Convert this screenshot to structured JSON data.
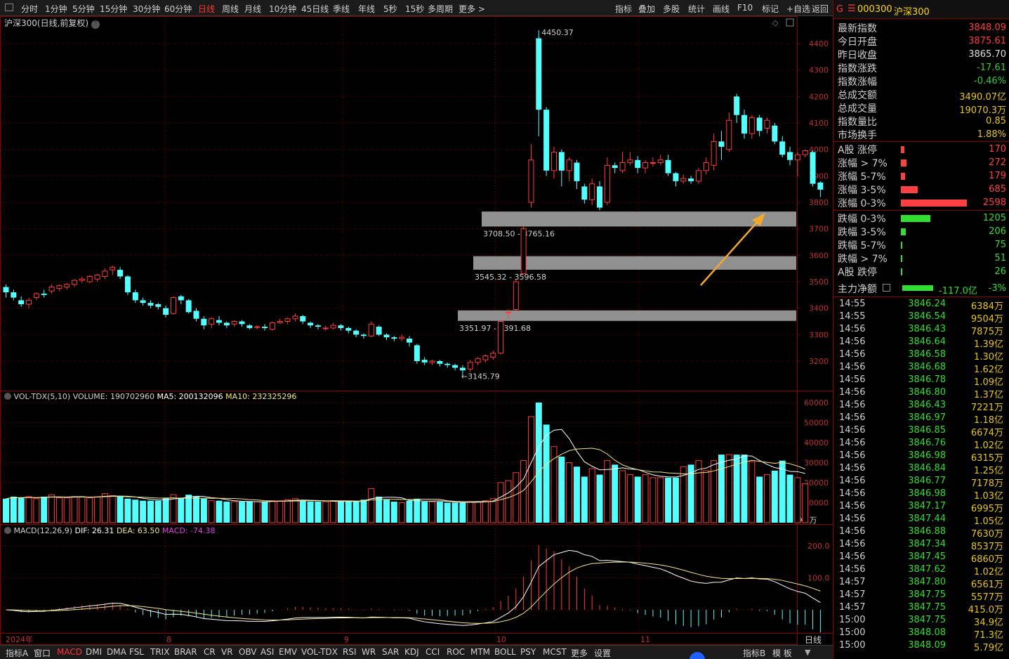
{
  "toolbar": {
    "periods": [
      "分时",
      "1分钟",
      "5分钟",
      "15分钟",
      "30分钟",
      "60分钟",
      "日线",
      "周线",
      "月线",
      "10分钟",
      "45日线",
      "季线",
      "年线",
      "5秒",
      "15秒",
      "多周期",
      "更多 >"
    ],
    "active_period": "日线",
    "actions": [
      "指标",
      "叠加",
      "多股",
      "统计",
      "画线",
      "F10",
      "标记",
      "+自选",
      "返回"
    ]
  },
  "chart": {
    "title": "沪深300(日线,前复权)",
    "candles": [
      [
        3480,
        3460,
        3490,
        3440
      ],
      [
        3460,
        3440,
        3470,
        3430
      ],
      [
        3430,
        3415,
        3445,
        3405
      ],
      [
        3415,
        3430,
        3440,
        3400
      ],
      [
        3440,
        3455,
        3460,
        3430
      ],
      [
        3455,
        3450,
        3470,
        3440
      ],
      [
        3465,
        3480,
        3490,
        3455
      ],
      [
        3475,
        3485,
        3490,
        3465
      ],
      [
        3480,
        3490,
        3495,
        3470
      ],
      [
        3490,
        3505,
        3510,
        3480
      ],
      [
        3505,
        3510,
        3520,
        3495
      ],
      [
        3500,
        3520,
        3525,
        3495
      ],
      [
        3510,
        3525,
        3530,
        3500
      ],
      [
        3520,
        3540,
        3550,
        3510
      ],
      [
        3545,
        3555,
        3560,
        3525
      ],
      [
        3545,
        3520,
        3555,
        3510
      ],
      [
        3520,
        3460,
        3525,
        3450
      ],
      [
        3460,
        3430,
        3470,
        3420
      ],
      [
        3430,
        3420,
        3440,
        3410
      ],
      [
        3420,
        3410,
        3430,
        3400
      ],
      [
        3415,
        3405,
        3420,
        3395
      ],
      [
        3400,
        3375,
        3410,
        3365
      ],
      [
        3380,
        3440,
        3445,
        3375
      ],
      [
        3445,
        3430,
        3450,
        3415
      ],
      [
        3430,
        3385,
        3435,
        3380
      ],
      [
        3390,
        3360,
        3400,
        3350
      ],
      [
        3360,
        3335,
        3370,
        3320
      ],
      [
        3340,
        3360,
        3365,
        3325
      ],
      [
        3355,
        3345,
        3370,
        3335
      ],
      [
        3345,
        3335,
        3350,
        3325
      ],
      [
        3340,
        3350,
        3355,
        3330
      ],
      [
        3350,
        3340,
        3355,
        3330
      ],
      [
        3335,
        3325,
        3340,
        3320
      ],
      [
        3330,
        3330,
        3335,
        3320
      ],
      [
        3330,
        3325,
        3340,
        3315
      ],
      [
        3320,
        3345,
        3350,
        3315
      ],
      [
        3345,
        3350,
        3360,
        3340
      ],
      [
        3350,
        3360,
        3365,
        3340
      ],
      [
        3360,
        3370,
        3380,
        3350
      ],
      [
        3370,
        3350,
        3375,
        3340
      ],
      [
        3345,
        3335,
        3350,
        3325
      ],
      [
        3335,
        3330,
        3340,
        3320
      ],
      [
        3325,
        3325,
        3335,
        3315
      ],
      [
        3325,
        3335,
        3345,
        3320
      ],
      [
        3335,
        3325,
        3340,
        3315
      ],
      [
        3325,
        3315,
        3330,
        3305
      ],
      [
        3315,
        3300,
        3320,
        3290
      ],
      [
        3300,
        3295,
        3305,
        3285
      ],
      [
        3295,
        3340,
        3350,
        3290
      ],
      [
        3330,
        3300,
        3335,
        3295
      ],
      [
        3300,
        3290,
        3305,
        3280
      ],
      [
        3290,
        3285,
        3295,
        3275
      ],
      [
        3285,
        3290,
        3300,
        3275
      ],
      [
        3285,
        3270,
        3295,
        3255
      ],
      [
        3260,
        3200,
        3265,
        3190
      ],
      [
        3205,
        3195,
        3215,
        3185
      ],
      [
        3195,
        3200,
        3205,
        3185
      ],
      [
        3200,
        3190,
        3205,
        3180
      ],
      [
        3190,
        3185,
        3195,
        3175
      ],
      [
        3185,
        3175,
        3190,
        3165
      ],
      [
        3175,
        3165,
        3185,
        3146
      ],
      [
        3170,
        3195,
        3205,
        3160
      ],
      [
        3195,
        3210,
        3215,
        3185
      ],
      [
        3205,
        3220,
        3225,
        3195
      ],
      [
        3215,
        3230,
        3240,
        3205
      ],
      [
        3230,
        3350,
        3355,
        3225
      ],
      [
        3385,
        3385,
        3395,
        3360
      ],
      [
        3395,
        3500,
        3510,
        3390
      ],
      [
        3530,
        3700,
        3710,
        3525
      ],
      [
        3800,
        3960,
        4020,
        3780
      ],
      [
        4420,
        4150,
        4450,
        4050
      ],
      [
        4150,
        3920,
        4160,
        3900
      ],
      [
        3920,
        3990,
        4010,
        3890
      ],
      [
        3990,
        3920,
        4000,
        3860
      ],
      [
        3920,
        3960,
        3970,
        3880
      ],
      [
        3950,
        3880,
        3960,
        3850
      ],
      [
        3860,
        3810,
        3870,
        3795
      ],
      [
        3810,
        3870,
        3890,
        3790
      ],
      [
        3860,
        3780,
        3880,
        3770
      ],
      [
        3800,
        3940,
        3970,
        3790
      ],
      [
        3940,
        3930,
        3950,
        3910
      ],
      [
        3920,
        3950,
        3990,
        3910
      ],
      [
        3950,
        3960,
        3990,
        3940
      ],
      [
        3960,
        3930,
        3975,
        3910
      ],
      [
        3930,
        3950,
        3960,
        3910
      ],
      [
        3950,
        3950,
        3970,
        3935
      ],
      [
        3950,
        3960,
        3980,
        3940
      ],
      [
        3960,
        3910,
        3980,
        3900
      ],
      [
        3910,
        3880,
        3915,
        3860
      ],
      [
        3880,
        3890,
        3905,
        3870
      ],
      [
        3890,
        3880,
        3900,
        3870
      ],
      [
        3880,
        3920,
        3930,
        3870
      ],
      [
        3920,
        3950,
        3970,
        3905
      ],
      [
        3940,
        4030,
        4060,
        3920
      ],
      [
        4030,
        4010,
        4070,
        3960
      ],
      [
        4000,
        4110,
        4140,
        3990
      ],
      [
        4200,
        4130,
        4210,
        4100
      ],
      [
        4130,
        4060,
        4150,
        4040
      ],
      [
        4060,
        4120,
        4130,
        4040
      ],
      [
        4120,
        4070,
        4130,
        4050
      ],
      [
        4080,
        4110,
        4120,
        4060
      ],
      [
        4090,
        4030,
        4100,
        4020
      ],
      [
        4030,
        3980,
        4050,
        3970
      ],
      [
        3990,
        3960,
        4010,
        3940
      ],
      [
        3960,
        3980,
        3990,
        3900
      ],
      [
        3980,
        3995,
        4000,
        3970
      ],
      [
        3990,
        3870,
        3995,
        3860
      ],
      [
        3875,
        3848,
        3880,
        3820
      ]
    ],
    "high_label": "4450.37",
    "low_label": "3145.79",
    "gap_bands": [
      {
        "lo": 3708.5,
        "hi": 3765.16,
        "label": "3708.50 - 3765.16"
      },
      {
        "lo": 3545.32,
        "hi": 3596.58,
        "label": "3545.32 - 3596.58"
      },
      {
        "lo": 3351.97,
        "hi": 3391.68,
        "label": "3351.97 - 3391.68"
      }
    ],
    "y_ticks": [
      "4400",
      "4300",
      "4200",
      "4100",
      "4000",
      "3900",
      "3800",
      "3700",
      "3600",
      "3500",
      "3400",
      "3300",
      "3200"
    ],
    "y_ticks_num": [
      4400,
      4300,
      4200,
      4100,
      4000,
      3900,
      3800,
      3700,
      3600,
      3500,
      3400,
      3300,
      3200
    ],
    "x_labels": [
      "2024年",
      "8",
      "9",
      "10",
      "11"
    ],
    "period_label": "日线"
  },
  "volume": {
    "name": "VOL-TDX(5,10)",
    "volume_label": "VOLUME: 190702960",
    "ma5_label": "MA5: 200132096",
    "ma10_label": "MA10: 232325296",
    "y_ticks": [
      "60000",
      "50000",
      "40000",
      "30000",
      "20000",
      "10000"
    ],
    "y_ticks_num": [
      60000,
      50000,
      40000,
      30000,
      20000,
      10000
    ],
    "unit": "X1万"
  },
  "macd": {
    "name": "MACD(12,26,9)",
    "dif_label": "DIF: 26.31",
    "dea_label": "DEA: 63.50",
    "macd_label": "MACD: -74.38",
    "y_ticks": [
      "200.0",
      "100.0"
    ],
    "y_ticks_num": [
      200,
      100
    ]
  },
  "quote": {
    "flag": "G",
    "code": "000300",
    "name": "沪深300",
    "rows": [
      {
        "k": "最新指数",
        "v": "3848.09",
        "c": "#ff3b3b"
      },
      {
        "k": "今日开盘",
        "v": "3875.61",
        "c": "#ff3b3b"
      },
      {
        "k": "昨日收盘",
        "v": "3865.70",
        "c": "#e0e0e0"
      },
      {
        "k": "指数涨跌",
        "v": "-17.61",
        "c": "#33cc33"
      },
      {
        "k": "指数涨幅",
        "v": "-0.46%",
        "c": "#33cc33"
      },
      {
        "k": "总成交额",
        "v": "3490.07亿",
        "c": "#e6c619"
      },
      {
        "k": "总成交量",
        "v": "19070.3万",
        "c": "#e6c619"
      },
      {
        "k": "指数量比",
        "v": "0.85",
        "c": "#e6c619"
      },
      {
        "k": "市场换手",
        "v": "1.88%",
        "c": "#e6c619"
      }
    ],
    "breadth": [
      {
        "k": "A股 涨停",
        "v": "170",
        "pct": 0.05,
        "c": "#ff4040"
      },
      {
        "k": "涨幅 > 7%",
        "v": "272",
        "pct": 0.08,
        "c": "#ff4040"
      },
      {
        "k": "涨幅 5-7%",
        "v": "179",
        "pct": 0.06,
        "c": "#ff4040"
      },
      {
        "k": "涨幅 3-5%",
        "v": "685",
        "pct": 0.25,
        "c": "#ff4040"
      },
      {
        "k": "涨幅 0-3%",
        "v": "2598",
        "pct": 1.0,
        "c": "#ff4040"
      },
      {
        "k": "跌幅 0-3%",
        "v": "1205",
        "pct": 0.45,
        "c": "#33dd33"
      },
      {
        "k": "跌幅 3-5%",
        "v": "206",
        "pct": 0.07,
        "c": "#33dd33"
      },
      {
        "k": "跌幅 5-7%",
        "v": "75",
        "pct": 0.02,
        "c": "#33dd33"
      },
      {
        "k": "跌幅 > 7%",
        "v": "51",
        "pct": 0.015,
        "c": "#33dd33"
      },
      {
        "k": "A股 跌停",
        "v": "26",
        "pct": 0.01,
        "c": "#33dd33"
      }
    ],
    "net_flow_label": "主力净额",
    "net_flow_value": "-117.0亿",
    "net_flow_pct": "-3%"
  },
  "ticks": [
    [
      "14:55",
      "3846.24",
      "6384万"
    ],
    [
      "14:55",
      "3846.54",
      "9504万"
    ],
    [
      "14:56",
      "3846.43",
      "7875万"
    ],
    [
      "14:56",
      "3846.64",
      "1.39亿"
    ],
    [
      "14:56",
      "3846.58",
      "1.30亿"
    ],
    [
      "14:56",
      "3846.68",
      "1.62亿"
    ],
    [
      "14:56",
      "3846.78",
      "1.09亿"
    ],
    [
      "14:56",
      "3846.80",
      "1.37亿"
    ],
    [
      "14:56",
      "3846.43",
      "7221万"
    ],
    [
      "14:56",
      "3846.97",
      "1.18亿"
    ],
    [
      "14:56",
      "3846.85",
      "6674万"
    ],
    [
      "14:56",
      "3846.76",
      "1.02亿"
    ],
    [
      "14:56",
      "3846.98",
      "6315万"
    ],
    [
      "14:56",
      "3846.84",
      "1.25亿"
    ],
    [
      "14:56",
      "3846.77",
      "7178万"
    ],
    [
      "14:56",
      "3846.98",
      "1.03亿"
    ],
    [
      "14:56",
      "3847.17",
      "6995万"
    ],
    [
      "14:56",
      "3847.44",
      "1.05亿"
    ],
    [
      "14:56",
      "3846.88",
      "7630万"
    ],
    [
      "14:56",
      "3847.34",
      "8537万"
    ],
    [
      "14:56",
      "3847.45",
      "6860万"
    ],
    [
      "14:56",
      "3847.62",
      "1.02亿"
    ],
    [
      "14:57",
      "3847.80",
      "6561万"
    ],
    [
      "14:57",
      "3847.75",
      "5577万"
    ],
    [
      "14:57",
      "3847.75",
      "415.0万"
    ],
    [
      "15:00",
      "3847.75",
      "34.9亿"
    ],
    [
      "15:00",
      "3848.08",
      "71.3亿"
    ],
    [
      "15:00",
      "3848.09",
      "5.79亿"
    ]
  ],
  "bottom_tabs": [
    "指标A",
    "窗口",
    "MACD",
    "DMI",
    "DMA",
    "FSL",
    "TRIX",
    "BRAR",
    "CR",
    "VR",
    "OBV",
    "ASI",
    "EMV",
    "VOL-TDX",
    "RSI",
    "WR",
    "SAR",
    "KDJ",
    "CCI",
    "ROC",
    "MTM",
    "BOLL",
    "PSY",
    "MCST",
    "更多",
    "设置"
  ],
  "active_bottom_tab": "MACD",
  "bottom_right": [
    "指标B",
    "模 板"
  ],
  "colors": {
    "up": "#ff3b3b",
    "down": "#54ffff",
    "grid": "#8b0000",
    "ma5": "#ffffff",
    "ma10": "#f0e68c",
    "arrow": "#f0a830",
    "band": "#909090"
  }
}
